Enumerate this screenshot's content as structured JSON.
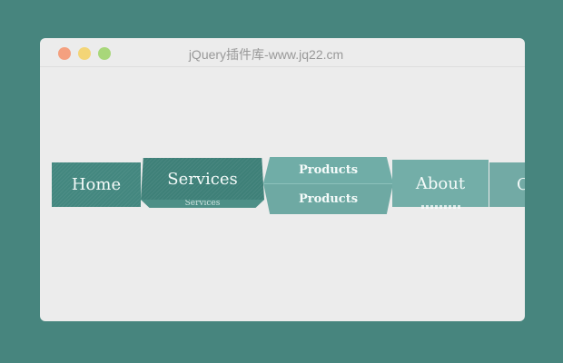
{
  "window": {
    "title": "jQuery插件库-www.jq22.cm"
  },
  "menu": {
    "items": [
      {
        "label": "Home"
      },
      {
        "label": "Services"
      },
      {
        "label": "Products",
        "flip_label": "Products"
      },
      {
        "label": "About"
      },
      {
        "label": "C"
      }
    ]
  },
  "colors": {
    "background": "#47857e",
    "window": "#ececec",
    "item_dark": "#43877f",
    "item_light": "#73aea8"
  },
  "icons": [
    "close-dot",
    "minimize-dot",
    "maximize-dot"
  ]
}
